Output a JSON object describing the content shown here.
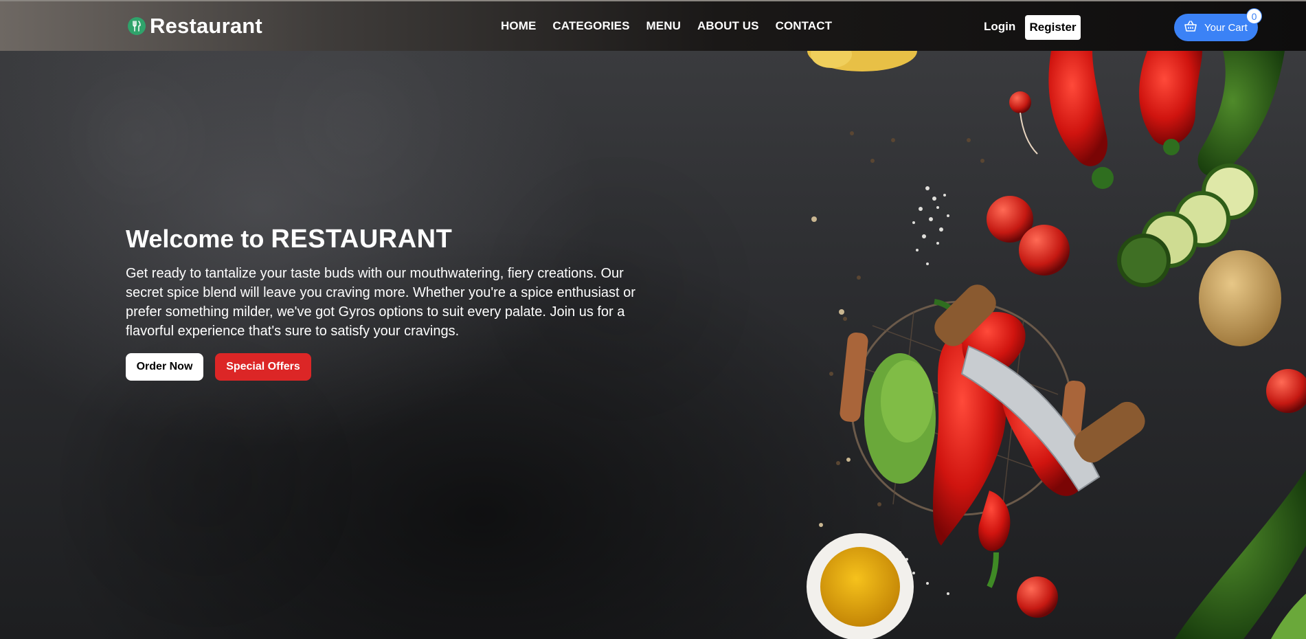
{
  "brand": {
    "name": "Restaurant",
    "icon": "fork-knife-icon",
    "icon_color": "#2fa36b"
  },
  "nav": {
    "items": [
      "HOME",
      "CATEGORIES",
      "MENU",
      "ABOUT US",
      "CONTACT"
    ],
    "login_label": "Login",
    "register_label": "Register",
    "cart_label": "Your Cart",
    "cart_count": "0",
    "cart_icon": "basket-icon",
    "cart_color": "#3b82f6"
  },
  "hero": {
    "title_prefix": "Welcome to ",
    "title_brand": "RESTAURANT",
    "body": "Get ready to tantalize your taste buds with our mouthwatering, fiery creations. Our secret spice blend will leave you craving more. Whether you're a spice enthusiast or prefer something milder, we've got Gyros options to suit every palate. Join us for a flavorful experience that's sure to satisfy your cravings.",
    "order_label": "Order Now",
    "offers_label": "Special Offers",
    "offers_color": "#dc2626"
  }
}
